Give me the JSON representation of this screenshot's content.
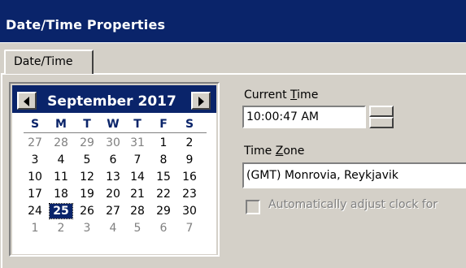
{
  "window": {
    "title": "Date/Time Properties"
  },
  "tabs": [
    {
      "label": "Date/Time"
    }
  ],
  "calendar": {
    "month_label": "September 2017",
    "weekdays": [
      "S",
      "M",
      "T",
      "W",
      "T",
      "F",
      "S"
    ],
    "weeks": [
      [
        {
          "d": "27",
          "other": true
        },
        {
          "d": "28",
          "other": true
        },
        {
          "d": "29",
          "other": true
        },
        {
          "d": "30",
          "other": true
        },
        {
          "d": "31",
          "other": true
        },
        {
          "d": "1"
        },
        {
          "d": "2"
        }
      ],
      [
        {
          "d": "3"
        },
        {
          "d": "4"
        },
        {
          "d": "5"
        },
        {
          "d": "6"
        },
        {
          "d": "7"
        },
        {
          "d": "8"
        },
        {
          "d": "9"
        }
      ],
      [
        {
          "d": "10"
        },
        {
          "d": "11"
        },
        {
          "d": "12"
        },
        {
          "d": "13"
        },
        {
          "d": "14"
        },
        {
          "d": "15"
        },
        {
          "d": "16"
        }
      ],
      [
        {
          "d": "17"
        },
        {
          "d": "18"
        },
        {
          "d": "19"
        },
        {
          "d": "20"
        },
        {
          "d": "21"
        },
        {
          "d": "22"
        },
        {
          "d": "23"
        }
      ],
      [
        {
          "d": "24"
        },
        {
          "d": "25",
          "selected": true
        },
        {
          "d": "26"
        },
        {
          "d": "27"
        },
        {
          "d": "28"
        },
        {
          "d": "29"
        },
        {
          "d": "30"
        }
      ],
      [
        {
          "d": "1",
          "other": true
        },
        {
          "d": "2",
          "other": true
        },
        {
          "d": "3",
          "other": true
        },
        {
          "d": "4",
          "other": true
        },
        {
          "d": "5",
          "other": true
        },
        {
          "d": "6",
          "other": true
        },
        {
          "d": "7",
          "other": true
        }
      ]
    ]
  },
  "time": {
    "label": "Current Time",
    "label_access_key": "T",
    "value": "10:00:47 AM"
  },
  "timezone": {
    "label": "Time Zone",
    "label_access_key": "Z",
    "value": "(GMT) Monrovia, Reykjavik"
  },
  "auto_adjust": {
    "label": "Automatically adjust clock for",
    "checked": false,
    "enabled": false
  },
  "colors": {
    "title_bar": "#0a246a",
    "face": "#d4d0c8",
    "selected_day": "#0a246a"
  }
}
